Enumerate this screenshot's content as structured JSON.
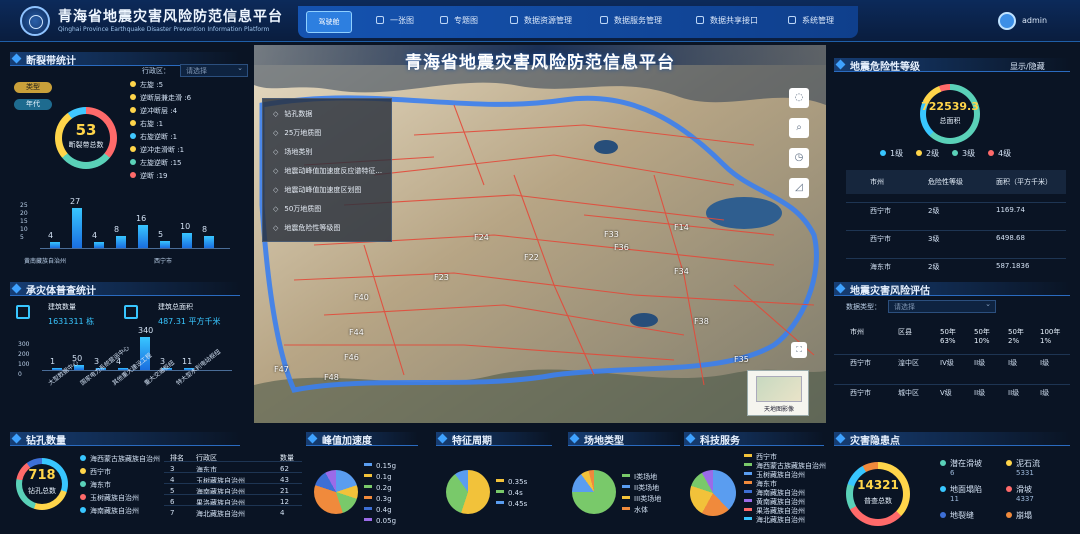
{
  "header": {
    "title": "青海省地震灾害风险防范信息平台",
    "subtitle": "Qinghai Province Earthquake Disaster Prevention Information Platform",
    "nav": [
      {
        "label": "驾驶舱"
      },
      {
        "label": "一张图"
      },
      {
        "label": "专题图"
      },
      {
        "label": "数据资源管理"
      },
      {
        "label": "数据服务管理"
      },
      {
        "label": "数据共享接口"
      },
      {
        "label": "系统管理"
      }
    ],
    "user": "admin"
  },
  "fault": {
    "title": "断裂带统计",
    "region_label": "行政区：",
    "region_placeholder": "请选择",
    "tags": [
      "类型",
      "年代"
    ],
    "total_value": "53",
    "total_label": "断裂带总数",
    "legend": [
      {
        "text": "左旋 :5",
        "color": "#ffd54a"
      },
      {
        "text": "逆断层兼走滑 :6",
        "color": "#ffd54a"
      },
      {
        "text": "逆冲断层 :4",
        "color": "#ffd54a"
      },
      {
        "text": "右旋 :1",
        "color": "#ffd54a"
      },
      {
        "text": "右旋逆断 :1",
        "color": "#40c8ff"
      },
      {
        "text": "逆冲走滑断 :1",
        "color": "#ffd54a"
      },
      {
        "text": "左旋逆断 :15",
        "color": "#5ad1b8"
      },
      {
        "text": "逆断 :19",
        "color": "#ff6a6a"
      }
    ],
    "bar_labels": [
      "4",
      "27",
      "4",
      "8",
      "16",
      "5",
      "10",
      "8"
    ],
    "yticks": [
      "25",
      "20",
      "15",
      "10",
      "5"
    ],
    "xlabels": [
      "黄南藏族自治州",
      "西宁市"
    ]
  },
  "chart_data": [
    {
      "type": "bar",
      "title": "断裂带统计",
      "categories": [
        "",
        "",
        "",
        "",
        "",
        "",
        "",
        ""
      ],
      "values": [
        4,
        27,
        4,
        8,
        16,
        5,
        10,
        8
      ],
      "ylim": [
        0,
        30
      ]
    },
    {
      "type": "bar",
      "title": "承灾体普查统计",
      "categories": [
        "大型数据中心",
        "国家电力系统营运中心",
        "其他重大建设工程",
        "重大交通枢纽",
        "特大型水利电站枢纽"
      ],
      "values": [
        1,
        50,
        3,
        4,
        340,
        3,
        11
      ],
      "ylim": [
        0,
        350
      ]
    },
    {
      "type": "pie",
      "title": "峰值加速度",
      "categories": [
        "0.15g",
        "0.1g",
        "0.2g",
        "0.3g",
        "0.4g",
        "0.05g"
      ],
      "values": [
        20,
        10,
        15,
        35,
        12,
        8
      ]
    },
    {
      "type": "pie",
      "title": "特征周期",
      "categories": [
        "0.35s",
        "0.4s",
        "0.45s"
      ],
      "values": [
        55,
        35,
        10
      ]
    },
    {
      "type": "pie",
      "title": "场地类型",
      "categories": [
        "I类场地",
        "II类场地",
        "III类场地",
        "水体"
      ],
      "values": [
        75,
        15,
        6,
        4
      ]
    }
  ],
  "building": {
    "title": "承灾体普查统计",
    "count_label": "建筑数量",
    "count_value": "1631311 栋",
    "area_label": "建筑总面积",
    "area_value": "487.31 平方千米",
    "bar_labels": [
      "1",
      "50",
      "3",
      "4",
      "340",
      "3",
      "11"
    ],
    "yticks": [
      "300",
      "200",
      "100",
      "0"
    ],
    "xlabels": [
      "大型数据中心",
      "国家电力系统营运中心",
      "其他重大建设工程",
      "重大交通枢纽",
      "特大型水利电站枢纽"
    ]
  },
  "map": {
    "title": "青海省地震灾害风险防范信息平台",
    "layers": [
      "钻孔数据",
      "25万地质图",
      "场地类别",
      "地震动峰值加速度反应谱特征...",
      "地震动峰值加速度区划图",
      "50万地质图",
      "地震危险性等级图"
    ],
    "minimap_label": "天地图影像",
    "labels": [
      "F22",
      "F24",
      "F23",
      "F33",
      "F14",
      "F34",
      "F36",
      "F40",
      "F44",
      "F46",
      "F47",
      "F48",
      "F35",
      "F38"
    ]
  },
  "risk_level": {
    "title": "地震危险性等级",
    "toggle": "显示/隐藏",
    "total_value": "722539.3",
    "total_label": "总面积",
    "legend": [
      {
        "text": "1级",
        "color": "#38c6ff"
      },
      {
        "text": "2级",
        "color": "#ffd54a"
      },
      {
        "text": "3级",
        "color": "#5ad1b8"
      },
      {
        "text": "4级",
        "color": "#ff6a6a"
      }
    ],
    "headers": [
      "市州",
      "危险性等级",
      "面积（平方千米）"
    ],
    "rows": [
      [
        "西宁市",
        "2级",
        "1169.74"
      ],
      [
        "西宁市",
        "3级",
        "6498.68"
      ],
      [
        "海东市",
        "2级",
        "587.1836"
      ]
    ]
  },
  "risk_eval": {
    "title": "地震灾害风险评估",
    "type_label": "数据类型：",
    "type_placeholder": "请选择",
    "headers": [
      "市州",
      "区县",
      "50年\n63%",
      "50年\n10%",
      "50年\n2%",
      "100年\n1%"
    ],
    "rows": [
      [
        "西宁市",
        "湟中区",
        "IV级",
        "II级",
        "I级",
        "I级"
      ],
      [
        "西宁市",
        "城中区",
        "V级",
        "II级",
        "II级",
        "I级"
      ]
    ]
  },
  "boreholes": {
    "title": "钻孔数量",
    "total_value": "718",
    "total_label": "钻孔总数",
    "legend": [
      {
        "text": "海西蒙古族藏族自治州",
        "color": "#38c6ff"
      },
      {
        "text": "西宁市",
        "color": "#ffd54a"
      },
      {
        "text": "海东市",
        "color": "#5ad1b8"
      },
      {
        "text": "玉树藏族自治州",
        "color": "#ff6a6a"
      },
      {
        "text": "海南藏族自治州",
        "color": "#38c6ff"
      }
    ],
    "headers": [
      "排名",
      "行政区",
      "数量"
    ],
    "rows": [
      [
        "3",
        "海东市",
        "62"
      ],
      [
        "4",
        "玉树藏族自治州",
        "43"
      ],
      [
        "5",
        "海南藏族自治州",
        "21"
      ],
      [
        "6",
        "果洛藏族自治州",
        "12"
      ],
      [
        "7",
        "海北藏族自治州",
        "4"
      ]
    ]
  },
  "pga": {
    "title": "峰值加速度",
    "legend": [
      "0.15g",
      "0.1g",
      "0.2g",
      "0.3g",
      "0.4g",
      "0.05g"
    ],
    "colors": [
      "#5a9df0",
      "#f2c23a",
      "#79c96a",
      "#f08a3c",
      "#3d6fd6",
      "#9b6be8"
    ]
  },
  "period": {
    "title": "特征周期",
    "legend": [
      "0.35s",
      "0.4s",
      "0.45s"
    ],
    "colors": [
      "#f2c23a",
      "#79c96a",
      "#5a9df0"
    ]
  },
  "site": {
    "title": "场地类型",
    "legend": [
      "I类场地",
      "II类场地",
      "III类场地",
      "水体"
    ],
    "colors": [
      "#79c96a",
      "#5a9df0",
      "#f2c23a",
      "#f08a3c"
    ]
  },
  "tech": {
    "title": "科技服务",
    "items": [
      "西宁市",
      "海西蒙古族藏族自治州",
      "玉树藏族自治州",
      "海东市",
      "海南藏族自治州",
      "黄南藏族自治州",
      "果洛藏族自治州",
      "海北藏族自治州"
    ],
    "colors": [
      "#f2c23a",
      "#79c96a",
      "#5a9df0",
      "#f08a3c",
      "#3d6fd6",
      "#9b6be8",
      "#ff6a6a",
      "#38c6ff"
    ]
  },
  "hazard": {
    "title": "灾害隐患点",
    "total_value": "14321",
    "total_label": "普查总数",
    "items": [
      {
        "name": "潜在滑坡",
        "value": "6",
        "color": "#5ad1b8"
      },
      {
        "name": "泥石流",
        "value": "5331",
        "color": "#ffd54a"
      },
      {
        "name": "地面塌陷",
        "value": "11",
        "color": "#38c6ff"
      },
      {
        "name": "滑坡",
        "value": "4337",
        "color": "#ff6a6a"
      },
      {
        "name": "地裂缝",
        "value": "",
        "color": "#3d6fd6"
      },
      {
        "name": "崩塌",
        "value": "",
        "color": "#f08a3c"
      }
    ]
  }
}
